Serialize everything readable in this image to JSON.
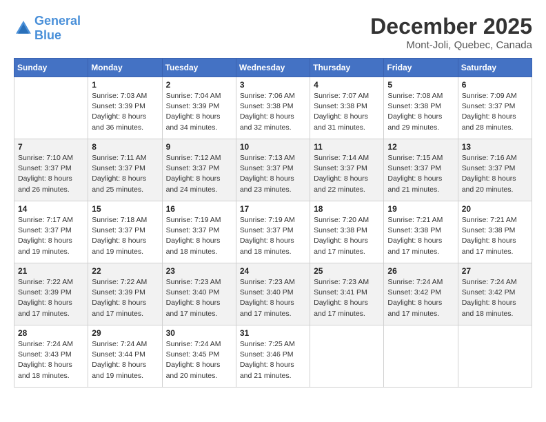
{
  "header": {
    "logo_general": "General",
    "logo_blue": "Blue",
    "month_title": "December 2025",
    "subtitle": "Mont-Joli, Quebec, Canada"
  },
  "days_of_week": [
    "Sunday",
    "Monday",
    "Tuesday",
    "Wednesday",
    "Thursday",
    "Friday",
    "Saturday"
  ],
  "weeks": [
    [
      {
        "day": "",
        "info": ""
      },
      {
        "day": "1",
        "info": "Sunrise: 7:03 AM\nSunset: 3:39 PM\nDaylight: 8 hours\nand 36 minutes."
      },
      {
        "day": "2",
        "info": "Sunrise: 7:04 AM\nSunset: 3:39 PM\nDaylight: 8 hours\nand 34 minutes."
      },
      {
        "day": "3",
        "info": "Sunrise: 7:06 AM\nSunset: 3:38 PM\nDaylight: 8 hours\nand 32 minutes."
      },
      {
        "day": "4",
        "info": "Sunrise: 7:07 AM\nSunset: 3:38 PM\nDaylight: 8 hours\nand 31 minutes."
      },
      {
        "day": "5",
        "info": "Sunrise: 7:08 AM\nSunset: 3:38 PM\nDaylight: 8 hours\nand 29 minutes."
      },
      {
        "day": "6",
        "info": "Sunrise: 7:09 AM\nSunset: 3:37 PM\nDaylight: 8 hours\nand 28 minutes."
      }
    ],
    [
      {
        "day": "7",
        "info": "Sunrise: 7:10 AM\nSunset: 3:37 PM\nDaylight: 8 hours\nand 26 minutes."
      },
      {
        "day": "8",
        "info": "Sunrise: 7:11 AM\nSunset: 3:37 PM\nDaylight: 8 hours\nand 25 minutes."
      },
      {
        "day": "9",
        "info": "Sunrise: 7:12 AM\nSunset: 3:37 PM\nDaylight: 8 hours\nand 24 minutes."
      },
      {
        "day": "10",
        "info": "Sunrise: 7:13 AM\nSunset: 3:37 PM\nDaylight: 8 hours\nand 23 minutes."
      },
      {
        "day": "11",
        "info": "Sunrise: 7:14 AM\nSunset: 3:37 PM\nDaylight: 8 hours\nand 22 minutes."
      },
      {
        "day": "12",
        "info": "Sunrise: 7:15 AM\nSunset: 3:37 PM\nDaylight: 8 hours\nand 21 minutes."
      },
      {
        "day": "13",
        "info": "Sunrise: 7:16 AM\nSunset: 3:37 PM\nDaylight: 8 hours\nand 20 minutes."
      }
    ],
    [
      {
        "day": "14",
        "info": "Sunrise: 7:17 AM\nSunset: 3:37 PM\nDaylight: 8 hours\nand 19 minutes."
      },
      {
        "day": "15",
        "info": "Sunrise: 7:18 AM\nSunset: 3:37 PM\nDaylight: 8 hours\nand 19 minutes."
      },
      {
        "day": "16",
        "info": "Sunrise: 7:19 AM\nSunset: 3:37 PM\nDaylight: 8 hours\nand 18 minutes."
      },
      {
        "day": "17",
        "info": "Sunrise: 7:19 AM\nSunset: 3:37 PM\nDaylight: 8 hours\nand 18 minutes."
      },
      {
        "day": "18",
        "info": "Sunrise: 7:20 AM\nSunset: 3:38 PM\nDaylight: 8 hours\nand 17 minutes."
      },
      {
        "day": "19",
        "info": "Sunrise: 7:21 AM\nSunset: 3:38 PM\nDaylight: 8 hours\nand 17 minutes."
      },
      {
        "day": "20",
        "info": "Sunrise: 7:21 AM\nSunset: 3:38 PM\nDaylight: 8 hours\nand 17 minutes."
      }
    ],
    [
      {
        "day": "21",
        "info": "Sunrise: 7:22 AM\nSunset: 3:39 PM\nDaylight: 8 hours\nand 17 minutes."
      },
      {
        "day": "22",
        "info": "Sunrise: 7:22 AM\nSunset: 3:39 PM\nDaylight: 8 hours\nand 17 minutes."
      },
      {
        "day": "23",
        "info": "Sunrise: 7:23 AM\nSunset: 3:40 PM\nDaylight: 8 hours\nand 17 minutes."
      },
      {
        "day": "24",
        "info": "Sunrise: 7:23 AM\nSunset: 3:40 PM\nDaylight: 8 hours\nand 17 minutes."
      },
      {
        "day": "25",
        "info": "Sunrise: 7:23 AM\nSunset: 3:41 PM\nDaylight: 8 hours\nand 17 minutes."
      },
      {
        "day": "26",
        "info": "Sunrise: 7:24 AM\nSunset: 3:42 PM\nDaylight: 8 hours\nand 17 minutes."
      },
      {
        "day": "27",
        "info": "Sunrise: 7:24 AM\nSunset: 3:42 PM\nDaylight: 8 hours\nand 18 minutes."
      }
    ],
    [
      {
        "day": "28",
        "info": "Sunrise: 7:24 AM\nSunset: 3:43 PM\nDaylight: 8 hours\nand 18 minutes."
      },
      {
        "day": "29",
        "info": "Sunrise: 7:24 AM\nSunset: 3:44 PM\nDaylight: 8 hours\nand 19 minutes."
      },
      {
        "day": "30",
        "info": "Sunrise: 7:24 AM\nSunset: 3:45 PM\nDaylight: 8 hours\nand 20 minutes."
      },
      {
        "day": "31",
        "info": "Sunrise: 7:25 AM\nSunset: 3:46 PM\nDaylight: 8 hours\nand 21 minutes."
      },
      {
        "day": "",
        "info": ""
      },
      {
        "day": "",
        "info": ""
      },
      {
        "day": "",
        "info": ""
      }
    ]
  ]
}
